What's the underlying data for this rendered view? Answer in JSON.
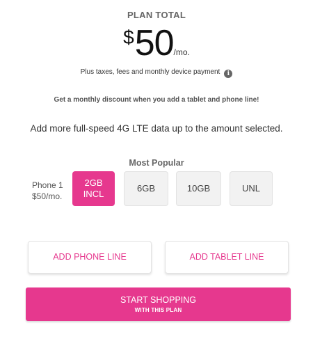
{
  "plan": {
    "label": "PLAN TOTAL",
    "currency": "$",
    "amount": "50",
    "unit": "/mo.",
    "fine_print": "Plus taxes, fees and monthly device payment",
    "info_icon_glyph": "i"
  },
  "discount_note": "Get a monthly discount when you add a tablet and phone line!",
  "data_note": "Add more full-speed 4G LTE data up to the amount selected.",
  "data_options": {
    "heading": "Most Popular",
    "phone_line": "Phone 1",
    "phone_price": "$50/mo.",
    "options": [
      {
        "label": "2GB",
        "sublabel": "INCL",
        "selected": true
      },
      {
        "label": "6GB",
        "selected": false
      },
      {
        "label": "10GB",
        "selected": false
      },
      {
        "label": "UNL",
        "selected": false
      }
    ]
  },
  "buttons": {
    "add_phone": "ADD PHONE LINE",
    "add_tablet": "ADD TABLET LINE",
    "start_main": "START SHOPPING",
    "start_sub": "WITH THIS PLAN"
  },
  "colors": {
    "brand": "#e6388e",
    "option_bg": "#f2f2f2",
    "heading_gray": "#666666"
  },
  "icons": {
    "info": "info-icon"
  }
}
